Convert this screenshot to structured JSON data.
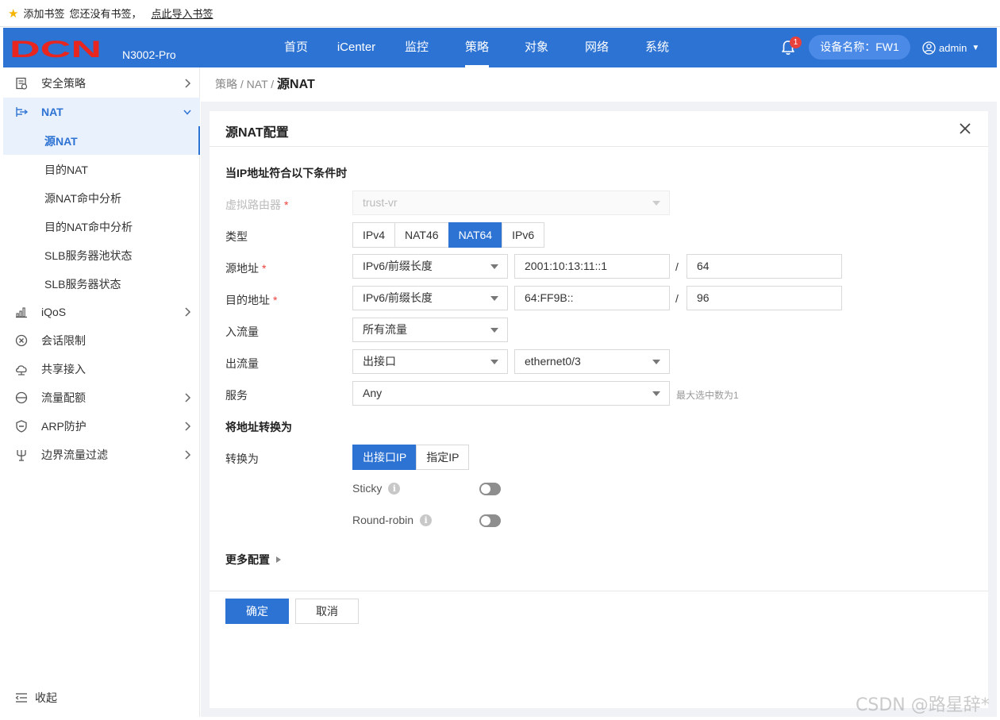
{
  "bookmark_bar": {
    "add_label": "添加书签",
    "empty_text": "您还没有书签，",
    "import_link": "点此导入书签"
  },
  "header": {
    "brand": "DCN",
    "brand_color": "#e8251f",
    "model": "N3002-Pro",
    "nav": [
      "首页",
      "iCenter",
      "监控",
      "策略",
      "对象",
      "网络",
      "系统"
    ],
    "active_nav": "策略",
    "notification_count": "1",
    "device_name": "设备名称：FW1",
    "user": "admin",
    "accent_color": "#2d73d3"
  },
  "sidebar": {
    "items": [
      {
        "label": "安全策略",
        "icon": "security-policy-icon"
      },
      {
        "label": "NAT",
        "icon": "nat-icon",
        "open": true,
        "children": [
          "源NAT",
          "目的NAT",
          "源NAT命中分析",
          "目的NAT命中分析",
          "SLB服务器池状态",
          "SLB服务器状态"
        ],
        "active_child": "源NAT"
      },
      {
        "label": "iQoS",
        "icon": "iqos-icon"
      },
      {
        "label": "会话限制",
        "icon": "session-limit-icon"
      },
      {
        "label": "共享接入",
        "icon": "shared-access-icon"
      },
      {
        "label": "流量配额",
        "icon": "traffic-quota-icon"
      },
      {
        "label": "ARP防护",
        "icon": "arp-shield-icon"
      },
      {
        "label": "边界流量过滤",
        "icon": "border-filter-icon"
      }
    ],
    "collapse_label": "收起"
  },
  "breadcrumb": {
    "path": "策略 / NAT / ",
    "current": "源NAT"
  },
  "form": {
    "title": "源NAT配置",
    "section1": "当IP地址符合以下条件时",
    "virtual_router": {
      "label": "虚拟路由器",
      "value": "trust-vr"
    },
    "type": {
      "label": "类型",
      "options": [
        "IPv4",
        "NAT46",
        "NAT64",
        "IPv6"
      ],
      "selected": "NAT64"
    },
    "source": {
      "label": "源地址",
      "mode": "IPv6/前缀长度",
      "address": "2001:10:13:11::1",
      "prefix": "64"
    },
    "dest": {
      "label": "目的地址",
      "mode": "IPv6/前缀长度",
      "address": "64:FF9B::",
      "prefix": "96"
    },
    "ingress": {
      "label": "入流量",
      "value": "所有流量"
    },
    "egress": {
      "label": "出流量",
      "value": "出接口",
      "interface": "ethernet0/3"
    },
    "service": {
      "label": "服务",
      "value": "Any",
      "hint": "最大选中数为1"
    },
    "section2": "将地址转换为",
    "translate": {
      "label": "转换为",
      "options": [
        "出接口IP",
        "指定IP"
      ],
      "selected": "出接口IP"
    },
    "sticky": {
      "label": "Sticky",
      "enabled": false
    },
    "round_robin": {
      "label": "Round-robin",
      "enabled": false
    },
    "more": "更多配置",
    "ok": "确定",
    "cancel": "取消",
    "required_mark": "*",
    "slash": "/"
  },
  "watermark": "CSDN @路星辞*"
}
